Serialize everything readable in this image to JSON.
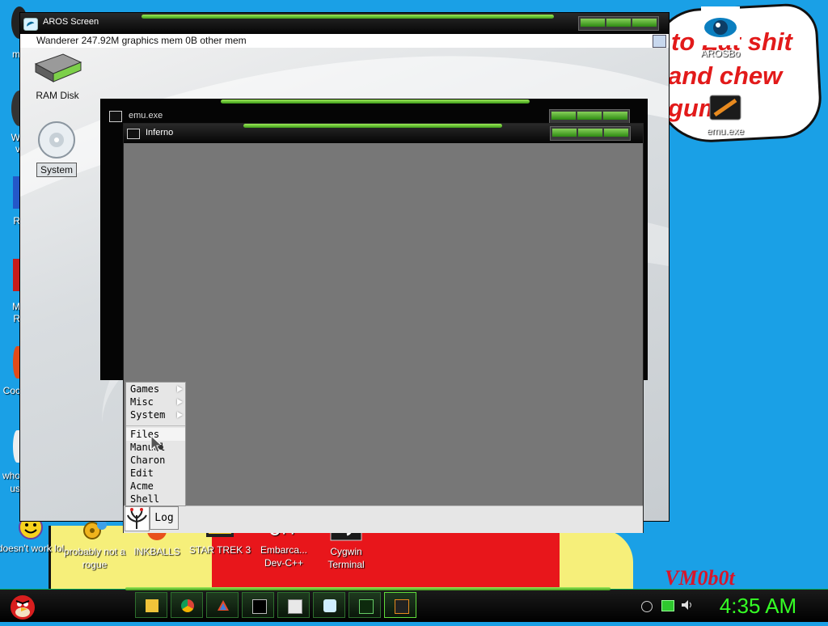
{
  "desktop": {
    "wallpaper_text": [
      "to Eat shit",
      "and chew",
      "gum"
    ],
    "signature": "VM0b0t",
    "left_labels": [
      "m",
      "W",
      "v",
      "R",
      "M",
      "R",
      "Coc",
      "who",
      "us"
    ],
    "icons_right": [
      {
        "label": "AROSBo",
        "icon": "aros-eye-icon"
      },
      {
        "label": "emu.exe",
        "icon": "emu-exe-icon"
      }
    ],
    "icons_bottom": [
      {
        "label": "doesn't work lol",
        "icon": "yahoo-messenger-icon"
      },
      {
        "label": "probably not a rogue",
        "icon": "gears-icon"
      },
      {
        "label": "INKBALLS",
        "icon": "inkballs-icon"
      },
      {
        "label": "STAR TREK 3",
        "icon": "star-wars-icon"
      },
      {
        "label": "Embarca... Dev-C++",
        "icon": "devcpp-icon"
      },
      {
        "label": "Cygwin Terminal",
        "icon": "cygwin-icon"
      }
    ]
  },
  "aros_screen": {
    "title": "AROS Screen",
    "status": "Wanderer 247.92M graphics mem 0B other mem",
    "icons": [
      {
        "label": "RAM Disk",
        "icon": "ram-disk-icon"
      },
      {
        "label": "System",
        "icon": "system-disk-icon"
      }
    ]
  },
  "emu_window": {
    "title": "emu.exe"
  },
  "inferno_window": {
    "title": "Inferno",
    "log_label": "Log",
    "menu": [
      {
        "label": "Games",
        "submenu": true
      },
      {
        "label": "Misc",
        "submenu": true
      },
      {
        "label": "System",
        "submenu": true
      },
      {
        "label": "Files",
        "submenu": false
      },
      {
        "label": "Manual",
        "submenu": false
      },
      {
        "label": "Charon",
        "submenu": false
      },
      {
        "label": "Edit",
        "submenu": false
      },
      {
        "label": "Acme",
        "submenu": false
      },
      {
        "label": "Shell",
        "submenu": false
      }
    ]
  },
  "taskbar": {
    "start_icon": "angry-bird-start-icon",
    "items": [
      "folder-icon",
      "chrome-icon",
      "app-icon",
      "cmd-icon",
      "window-icon",
      "aros-icon",
      "terminal-icon",
      "emu-icon"
    ],
    "tray": [
      "chevron-icon",
      "network-icon",
      "volume-icon"
    ],
    "clock": "4:35 AM"
  },
  "colors": {
    "accent_green": "#35ff25",
    "desktop_blue": "#1aa0e6"
  }
}
